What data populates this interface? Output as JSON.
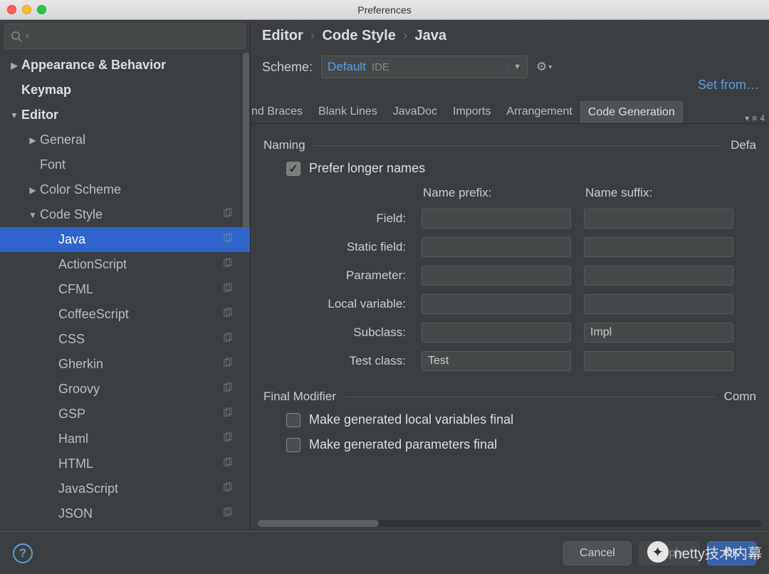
{
  "window": {
    "title": "Preferences"
  },
  "search": {
    "placeholder": ""
  },
  "tree": [
    {
      "label": "Appearance & Behavior",
      "depth": 0,
      "arrow": "right",
      "bold": true
    },
    {
      "label": "Keymap",
      "depth": 0,
      "bold": true
    },
    {
      "label": "Editor",
      "depth": 0,
      "arrow": "down",
      "bold": true
    },
    {
      "label": "General",
      "depth": 1,
      "arrow": "right"
    },
    {
      "label": "Font",
      "depth": 1
    },
    {
      "label": "Color Scheme",
      "depth": 1,
      "arrow": "right"
    },
    {
      "label": "Code Style",
      "depth": 1,
      "arrow": "down",
      "copy": true
    },
    {
      "label": "Java",
      "depth": 2,
      "selected": true,
      "copy": true
    },
    {
      "label": "ActionScript",
      "depth": 2,
      "copy": true
    },
    {
      "label": "CFML",
      "depth": 2,
      "copy": true
    },
    {
      "label": "CoffeeScript",
      "depth": 2,
      "copy": true
    },
    {
      "label": "CSS",
      "depth": 2,
      "copy": true
    },
    {
      "label": "Gherkin",
      "depth": 2,
      "copy": true
    },
    {
      "label": "Groovy",
      "depth": 2,
      "copy": true
    },
    {
      "label": "GSP",
      "depth": 2,
      "copy": true
    },
    {
      "label": "Haml",
      "depth": 2,
      "copy": true
    },
    {
      "label": "HTML",
      "depth": 2,
      "copy": true
    },
    {
      "label": "JavaScript",
      "depth": 2,
      "copy": true
    },
    {
      "label": "JSON",
      "depth": 2,
      "copy": true
    }
  ],
  "breadcrumb": [
    "Editor",
    "Code Style",
    "Java"
  ],
  "scheme": {
    "label": "Scheme:",
    "name": "Default",
    "tag": "IDE"
  },
  "set_from": "Set from…",
  "tabs": [
    "nd Braces",
    "Blank Lines",
    "JavaDoc",
    "Imports",
    "Arrangement",
    "Code Generation"
  ],
  "tabs_active_index": 5,
  "tabs_indicator": "4",
  "naming": {
    "section": "Naming",
    "prefer_longer": "Prefer longer names",
    "prefer_longer_checked": true,
    "right_cut_label": "Defa",
    "col_prefix": "Name prefix:",
    "col_suffix": "Name suffix:",
    "rows": [
      {
        "label": "Field:",
        "prefix": "",
        "suffix": ""
      },
      {
        "label": "Static field:",
        "prefix": "",
        "suffix": ""
      },
      {
        "label": "Parameter:",
        "prefix": "",
        "suffix": ""
      },
      {
        "label": "Local variable:",
        "prefix": "",
        "suffix": ""
      },
      {
        "label": "Subclass:",
        "prefix": "",
        "suffix": "Impl"
      },
      {
        "label": "Test class:",
        "prefix": "Test",
        "suffix": ""
      }
    ]
  },
  "final_modifier": {
    "section": "Final Modifier",
    "right_cut_label": "Comn",
    "opt1": "Make generated local variables final",
    "opt2": "Make generated parameters final"
  },
  "footer": {
    "cancel": "Cancel",
    "apply": "Apply",
    "ok": "OK"
  },
  "watermark": "netty技术内幕"
}
